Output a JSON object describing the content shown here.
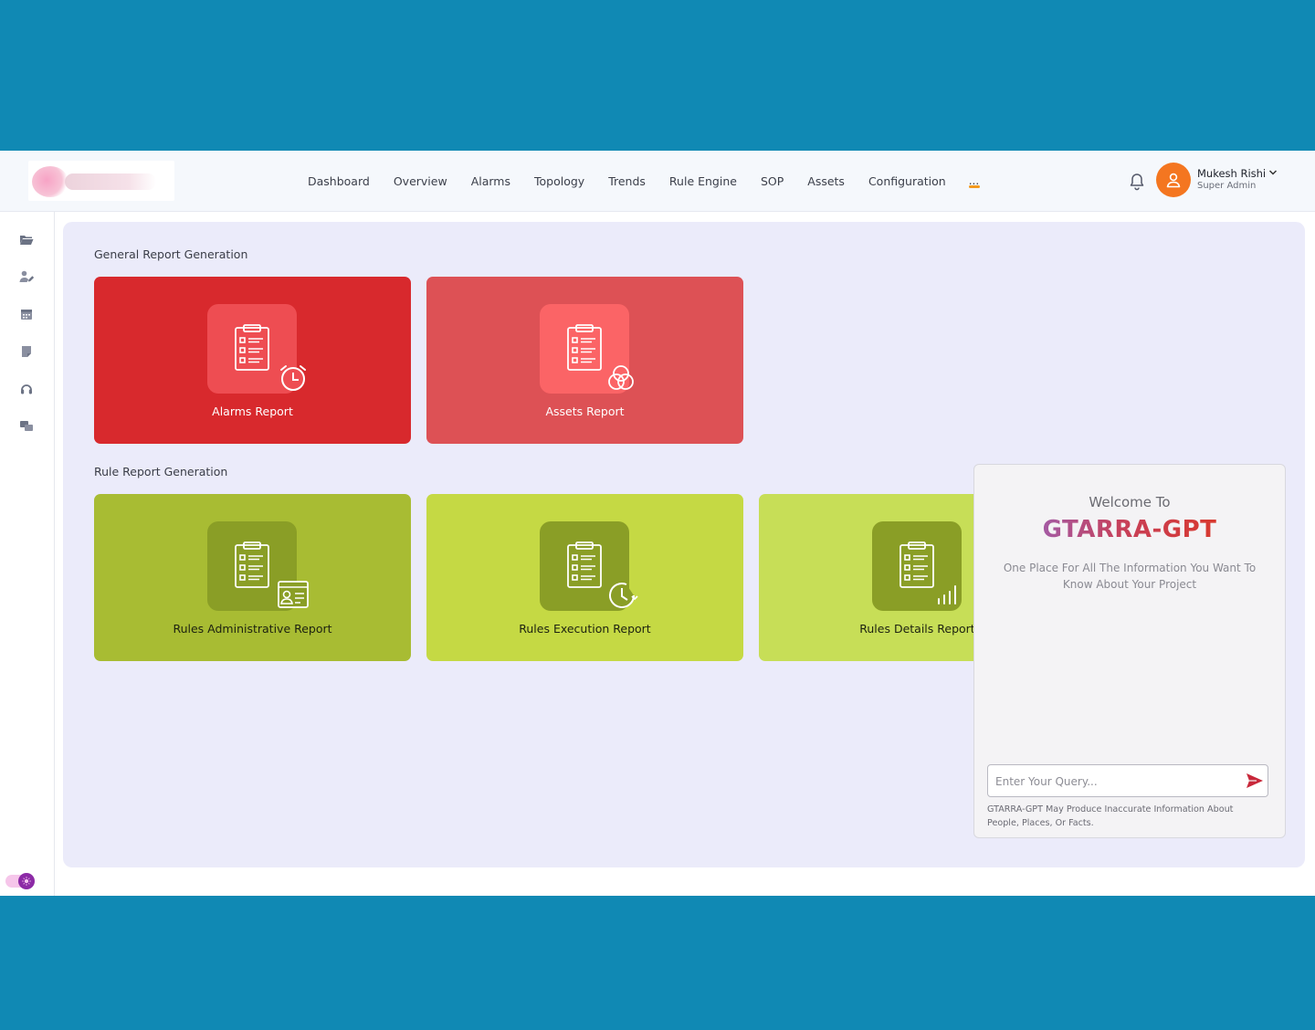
{
  "header": {
    "nav": [
      "Dashboard",
      "Overview",
      "Alarms",
      "Topology",
      "Trends",
      "Rule Engine",
      "SOP",
      "Assets",
      "Configuration"
    ],
    "more_label": "...",
    "user": {
      "name": "Mukesh Rishi",
      "role": "Super Admin"
    }
  },
  "sidebar": {
    "icons": [
      "folder-icon",
      "user-edit-icon",
      "calendar-icon",
      "note-icon",
      "headset-icon",
      "chat-icon"
    ]
  },
  "sections": {
    "general_title": "General Report Generation",
    "rule_title": "Rule Report Generation"
  },
  "cards": {
    "alarms": {
      "label": "Alarms Report",
      "bg": "#d8292d",
      "tile": "#ee4d52"
    },
    "assets": {
      "label": "Assets Report",
      "bg": "#dd5155",
      "tile": "#fb6466"
    },
    "rules_admin": {
      "label": "Rules Administrative Report",
      "bg": "#a8bc33",
      "tile": "#8a9e26"
    },
    "rules_exec": {
      "label": "Rules Execution Report",
      "bg": "#c5d944",
      "tile": "#8a9e26"
    },
    "rules_details": {
      "label": "Rules Details Report",
      "bg": "#c7de57",
      "tile": "#8a9e26"
    }
  },
  "gpt": {
    "welcome": "Welcome To",
    "title": "GTARRA-GPT",
    "subtitle": "One Place For All The Information You Want To Know About Your Project",
    "placeholder": "Enter Your Query...",
    "disclaimer": "GTARRA-GPT May Produce Inaccurate Information About People, Places, Or Facts."
  },
  "colors": {
    "accent": "#f47620",
    "nav_indicator": "#f39a1e",
    "send": "#c8283a",
    "toggle": "#8c2aa6"
  }
}
